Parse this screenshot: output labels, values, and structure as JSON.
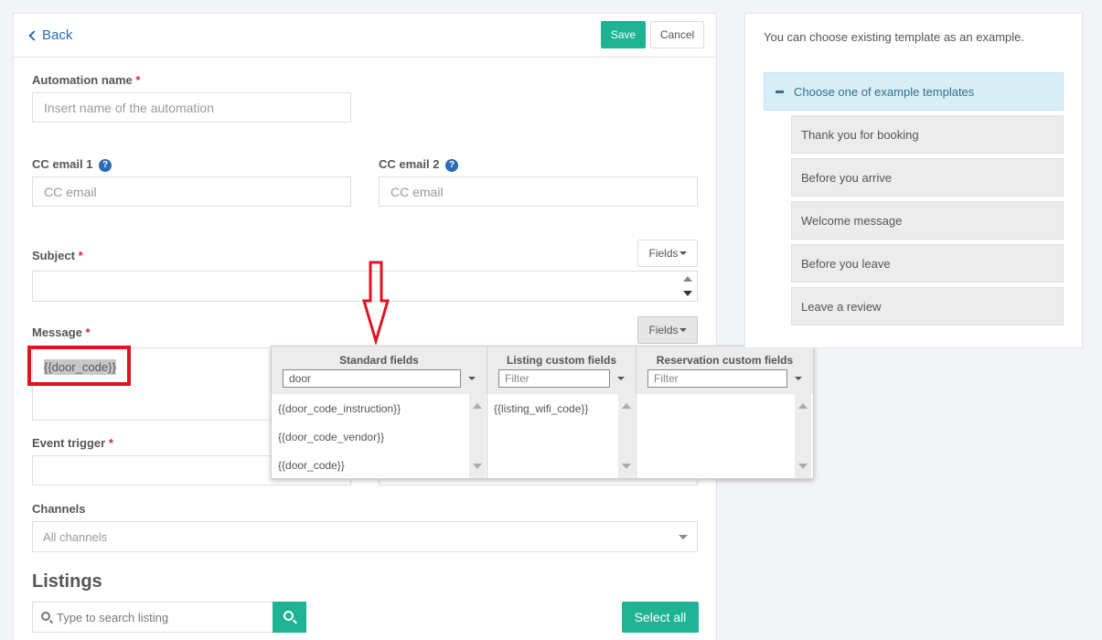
{
  "header": {
    "back_label": "Back",
    "save_label": "Save",
    "cancel_label": "Cancel"
  },
  "form": {
    "automation_name": {
      "label": "Automation name",
      "required_mark": "*",
      "placeholder": "Insert name of the automation"
    },
    "cc_email_1": {
      "label": "CC email 1",
      "help_icon": "?",
      "placeholder": "CC email"
    },
    "cc_email_2": {
      "label": "CC email 2",
      "help_icon": "?",
      "placeholder": "CC email"
    },
    "subject": {
      "label": "Subject",
      "required_mark": "*",
      "fields_button": "Fields",
      "value": ""
    },
    "message": {
      "label": "Message",
      "required_mark": "*",
      "fields_button": "Fields",
      "token": "{{door_code}}"
    },
    "event_trigger": {
      "label": "Event trigger",
      "required_mark": "*"
    },
    "channels": {
      "label": "Channels",
      "selected": "All channels"
    },
    "listings": {
      "heading": "Listings",
      "search_placeholder": "Type to search listing",
      "select_all_label": "Select all"
    }
  },
  "fields_popup": {
    "columns": [
      {
        "title": "Standard fields",
        "filter_value": "door",
        "items": [
          "{{door_code_instruction}}",
          "{{door_code_vendor}}",
          "{{door_code}}"
        ]
      },
      {
        "title": "Listing custom fields",
        "filter_placeholder": "Filter",
        "items": [
          "{{listing_wifi_code}}"
        ]
      },
      {
        "title": "Reservation custom fields",
        "filter_placeholder": "Filter",
        "items": []
      }
    ]
  },
  "side": {
    "intro": "You can choose existing template as an example.",
    "accordion_title": "Choose one of example templates",
    "templates": [
      "Thank you for booking",
      "Before you arrive",
      "Welcome message",
      "Before you leave",
      "Leave a review"
    ]
  },
  "colors": {
    "accent_green": "#1fb394",
    "link_blue": "#2a6bb3",
    "required_red": "#d9282f",
    "annotation_red": "#e0141e",
    "accordion_blue": "#d9edf7"
  },
  "icons": [
    "chevron-left-icon",
    "question-circle-icon",
    "search-icon",
    "minus-icon",
    "caret-down-icon",
    "annotation-arrow-down"
  ]
}
